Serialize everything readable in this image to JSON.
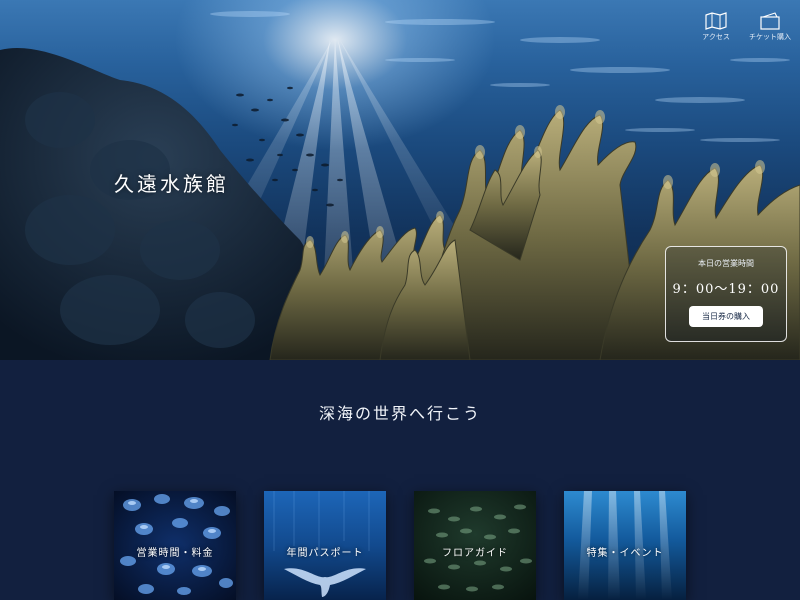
{
  "site": {
    "logo": "久遠水族館"
  },
  "header": {
    "access_label": "アクセス",
    "ticket_label": "チケット購入"
  },
  "hours": {
    "title": "本日の営業時間",
    "time": "9：00〜19：00",
    "buy_label": "当日券の購入"
  },
  "section": {
    "title": "深海の世界へ行こう"
  },
  "cards": [
    {
      "label": "営業時間・料金",
      "image": "jellyfish"
    },
    {
      "label": "年間パスポート",
      "image": "manta-ray"
    },
    {
      "label": "フロアガイド",
      "image": "fish-school"
    },
    {
      "label": "特集・イベント",
      "image": "sunrays-underwater"
    }
  ],
  "colors": {
    "page_bg": "#12203f",
    "button_bg": "#ffffff",
    "button_text": "#1a2b48"
  }
}
